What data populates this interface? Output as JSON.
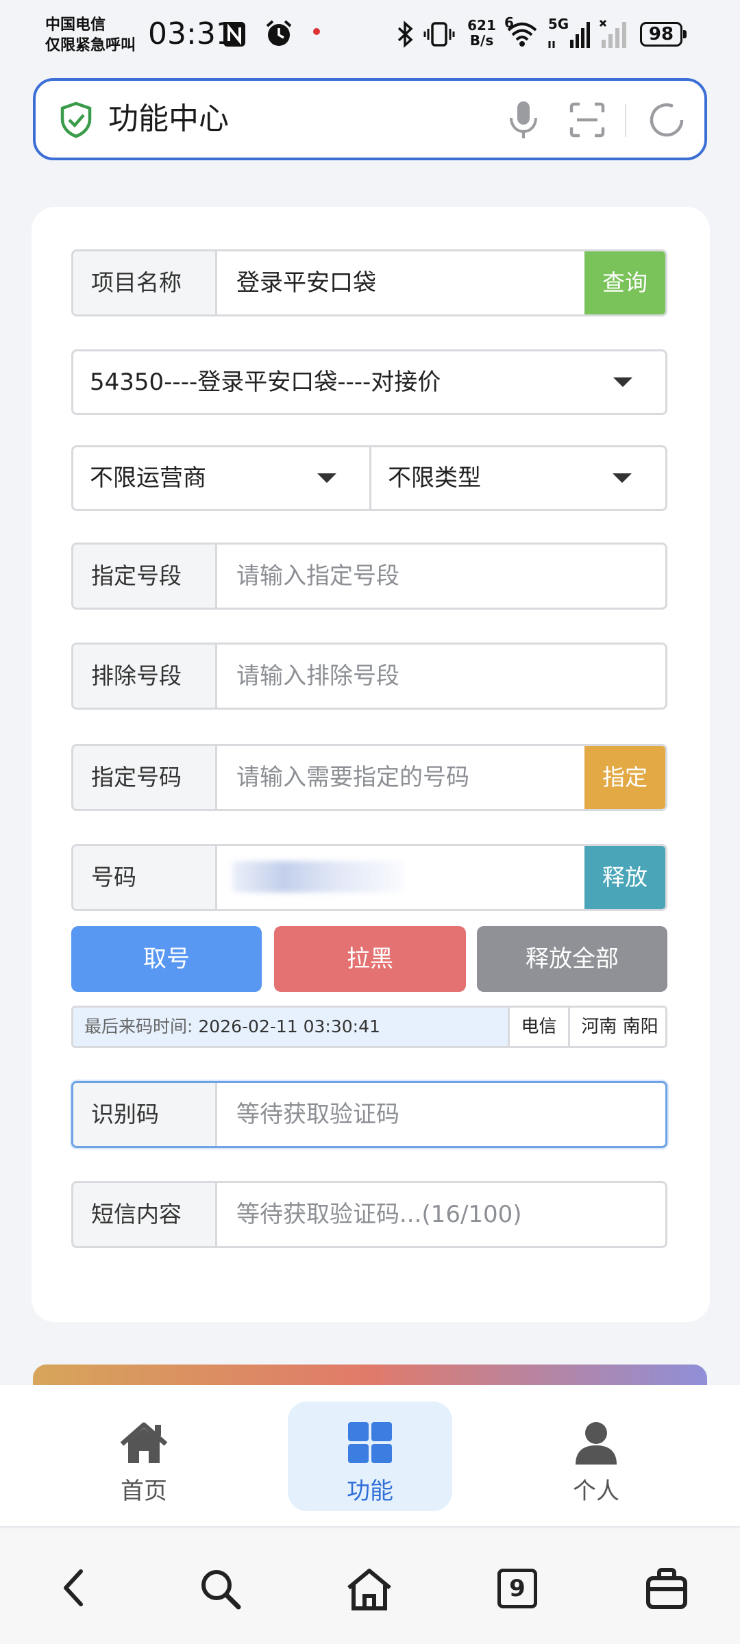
{
  "status": {
    "carrier_line1": "中国电信",
    "carrier_line2": "仅限紧急呼叫",
    "time": "03:31",
    "net_speed_top": "621",
    "net_speed_bottom": "B/s",
    "wifi_badge": "6",
    "signal_label": "5G",
    "battery": "98"
  },
  "address_bar": {
    "title": "功能中心"
  },
  "form": {
    "project": {
      "label": "项目名称",
      "value": "登录平安口袋",
      "action": "查询"
    },
    "project_select": "54350----登录平安口袋----对接价",
    "operator_select": "不限运营商",
    "type_select": "不限类型",
    "specify_segment": {
      "label": "指定号段",
      "placeholder": "请输入指定号段"
    },
    "exclude_segment": {
      "label": "排除号段",
      "placeholder": "请输入排除号段"
    },
    "specify_number": {
      "label": "指定号码",
      "placeholder": "请输入需要指定的号码",
      "action": "指定"
    },
    "number": {
      "label": "号码",
      "action": "释放"
    },
    "buttons": {
      "take": "取号",
      "blacklist": "拉黑",
      "release_all": "释放全部"
    },
    "info": {
      "time_key": "最后来码时间:",
      "time_value": "2026-02-11 03:30:41",
      "carrier": "电信",
      "region": "河南 南阳"
    },
    "code": {
      "label": "识别码",
      "placeholder": "等待获取验证码"
    },
    "sms": {
      "label": "短信内容",
      "placeholder": "等待获取验证码...(16/100)"
    }
  },
  "tabs": [
    {
      "label": "首页",
      "icon": "home-icon",
      "active": false
    },
    {
      "label": "功能",
      "icon": "grid-icon",
      "active": true
    },
    {
      "label": "个人",
      "icon": "person-icon",
      "active": false
    }
  ],
  "system_nav": {
    "tab_count": "9"
  },
  "colors": {
    "accent": "#3c6fd6",
    "query_green": "#7ac35a",
    "specify_orange": "#e2a944",
    "release_teal": "#4aa5b8",
    "take_blue": "#5898f2",
    "blacklist_red": "#e47272",
    "release_all_gray": "#8f9196"
  }
}
